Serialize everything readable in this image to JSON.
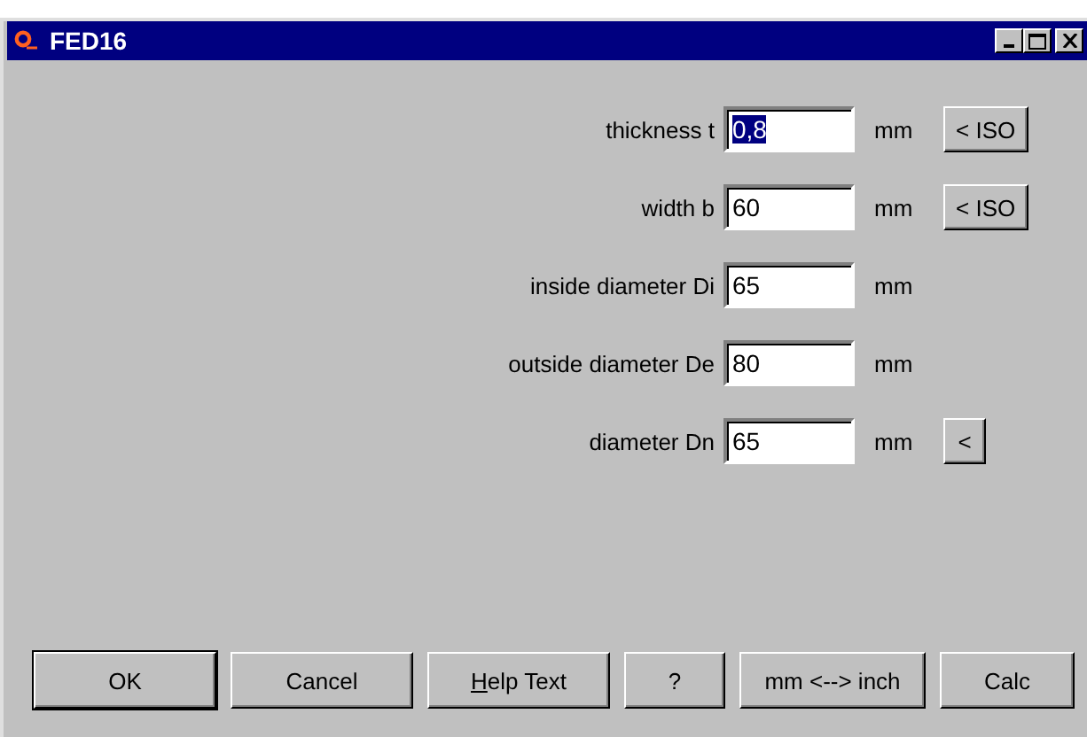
{
  "window": {
    "title": "FED16"
  },
  "fields": [
    {
      "label": "thickness t",
      "value": "0,8",
      "value_selected": true,
      "unit": "mm",
      "button": "< ISO"
    },
    {
      "label": "width b",
      "value": "60",
      "value_selected": false,
      "unit": "mm",
      "button": "< ISO"
    },
    {
      "label": "inside diameter Di",
      "value": "65",
      "value_selected": false,
      "unit": "mm"
    },
    {
      "label": "outside diameter De",
      "value": "80",
      "value_selected": false,
      "unit": "mm"
    },
    {
      "label": "diameter Dn",
      "value": "65",
      "value_selected": false,
      "unit": "mm",
      "button": "<"
    }
  ],
  "buttons": [
    {
      "label": "OK",
      "default": true
    },
    {
      "label": "Cancel",
      "default": false
    },
    {
      "label": "Help Text",
      "default": false,
      "underline_first": true
    },
    {
      "label": "?",
      "default": false
    },
    {
      "label": "mm <--> inch",
      "default": false
    },
    {
      "label": "Calc",
      "default": false
    }
  ]
}
